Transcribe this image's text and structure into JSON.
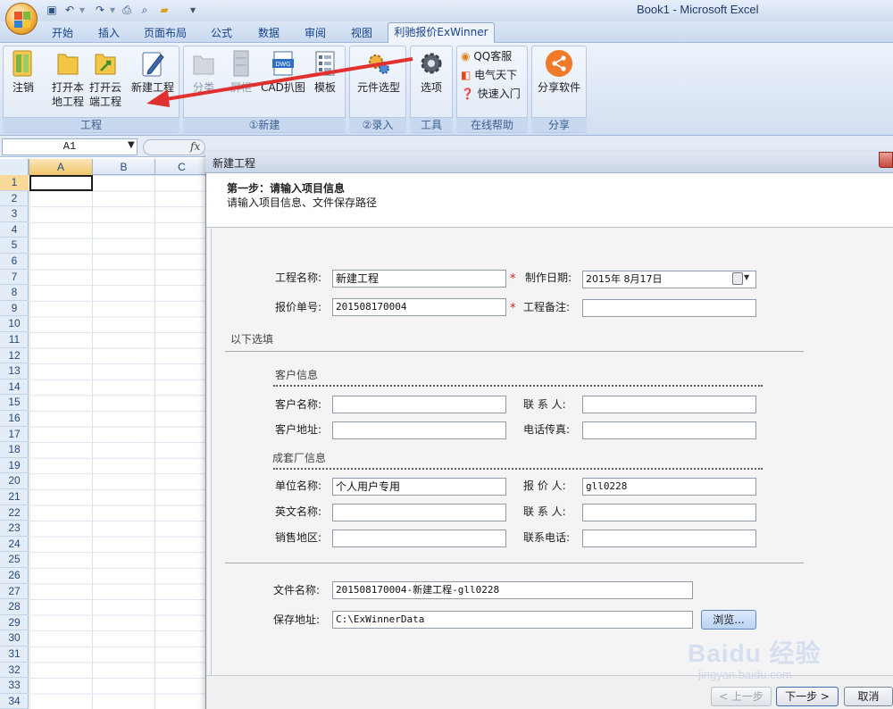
{
  "window": {
    "title": "Book1 - Microsoft Excel"
  },
  "tabs": [
    {
      "label": "开始"
    },
    {
      "label": "插入"
    },
    {
      "label": "页面布局"
    },
    {
      "label": "公式"
    },
    {
      "label": "数据"
    },
    {
      "label": "审阅"
    },
    {
      "label": "视图"
    },
    {
      "label": "利驰报价ExWinner"
    }
  ],
  "ribbon": {
    "groups": {
      "project": "工程",
      "new": "①新建",
      "input": "②录入",
      "tools": "工具",
      "help": "在线帮助",
      "share": "分享"
    },
    "buttons": {
      "logout": "注销",
      "open_local_1": "打开本",
      "open_local_2": "地工程",
      "open_cloud_1": "打开云",
      "open_cloud_2": "端工程",
      "new_project": "新建工程",
      "category": "分类",
      "cabinet": "屏柜",
      "cad": "CAD扒图",
      "template": "模板",
      "component_select": "元件选型",
      "options": "选项",
      "qq_service": "QQ客服",
      "electric_world": "电气天下",
      "quick_start": "快速入门",
      "share_software": "分享软件"
    }
  },
  "formula_bar": {
    "name_box": "A1",
    "fx": "fx"
  },
  "sheet": {
    "columns": [
      "A",
      "B",
      "C"
    ],
    "rows": [
      "1",
      "2",
      "3",
      "4",
      "5",
      "6",
      "7",
      "8",
      "9",
      "10",
      "11",
      "12",
      "13",
      "14",
      "15",
      "16",
      "17",
      "18",
      "19",
      "20",
      "21",
      "22",
      "23",
      "24",
      "25",
      "26",
      "27",
      "28",
      "29",
      "30",
      "31",
      "32",
      "33",
      "34"
    ]
  },
  "dialog": {
    "title": "新建工程",
    "step_title": "第一步：请输入项目信息",
    "step_subtitle": "请输入项目信息、文件保存路径",
    "labels": {
      "project_name": "工程名称:",
      "date": "制作日期:",
      "quote_no": "报价单号:",
      "remarks": "工程备注:",
      "optional": "以下选填",
      "customer_info": "客户信息",
      "customer_name": "客户名称:",
      "contact": "联 系 人:",
      "customer_addr": "客户地址:",
      "phone_fax": "电话传真:",
      "factory_info": "成套厂信息",
      "unit_name": "单位名称:",
      "quoter": "报 价 人:",
      "english_name": "英文名称:",
      "contact2": "联 系 人:",
      "sales_region": "销售地区:",
      "contact_phone": "联系电话:",
      "file_name": "文件名称:",
      "save_path": "保存地址:"
    },
    "values": {
      "project_name": "新建工程",
      "date": "2015年  8月17日",
      "quote_no": "201508170004",
      "remarks": "",
      "customer_name": "",
      "contact": "",
      "customer_addr": "",
      "phone_fax": "",
      "unit_name": "个人用户专用",
      "quoter": "gll0228",
      "english_name": "",
      "contact2": "",
      "sales_region": "",
      "contact_phone": "",
      "file_name": "201508170004-新建工程-gll0228",
      "save_path": "C:\\ExWinnerData"
    },
    "required_mark": "*",
    "buttons": {
      "browse": "浏览...",
      "prev": "< 上一步",
      "next": "下一步 >",
      "cancel": "取消"
    }
  },
  "watermark": {
    "brand": "Baidu 经验",
    "url": "jingyan.baidu.com"
  },
  "colors": {
    "annotation_arrow": "#e03030",
    "ribbon_bg": "#dde7f5",
    "required": "#d0211d"
  }
}
